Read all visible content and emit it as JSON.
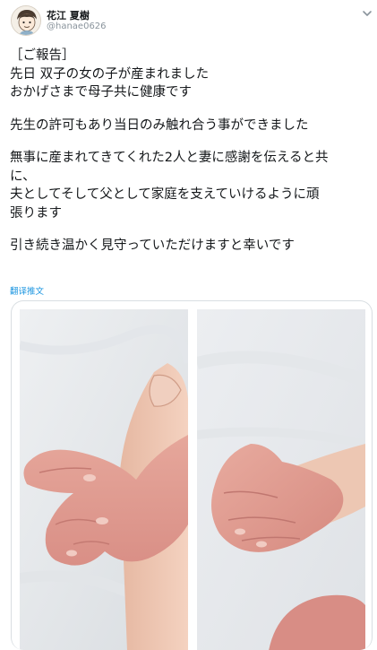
{
  "author": {
    "display_name": "花江 夏樹",
    "handle": "@hanae0626",
    "avatar_icon": "avatar-illustration-icon"
  },
  "menu_icon": "chevron-down-icon",
  "tweet": {
    "lines": [
      "［ご報告］",
      "先日 双子の女の子が産まれました",
      "おかげさまで母子共に健康です",
      "",
      "先生の許可もあり当日のみ触れ合う事ができました",
      "",
      "無事に産まれてきてくれた2人と妻に感謝を伝えると共",
      "に、",
      "夫としてそして父として家庭を支えていけるように頑",
      "張ります",
      "",
      "引き続き温かく見守っていただけますと幸いです"
    ],
    "translate_label": "翻译推文"
  },
  "colors": {
    "link": "#1b95e0",
    "text": "#14171a",
    "muted": "#8a949c",
    "border": "#d9dee2"
  }
}
